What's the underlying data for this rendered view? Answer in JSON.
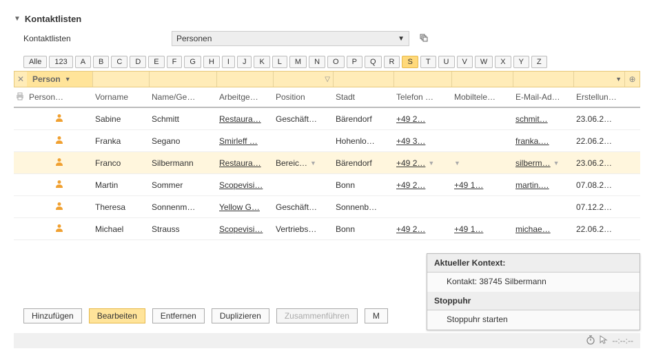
{
  "section": {
    "title": "Kontaktlisten"
  },
  "dropdown": {
    "label": "Kontaktlisten",
    "value": "Personen"
  },
  "alphaBar": {
    "all": "Alle",
    "nums": "123",
    "letters": [
      "A",
      "B",
      "C",
      "D",
      "E",
      "F",
      "G",
      "H",
      "I",
      "J",
      "K",
      "L",
      "M",
      "N",
      "O",
      "P",
      "Q",
      "R",
      "S",
      "T",
      "U",
      "V",
      "W",
      "X",
      "Y",
      "Z"
    ],
    "active": "S"
  },
  "filterHead": "Person",
  "columns": {
    "type": "Person…",
    "vorname": "Vorname",
    "name": "Name/Ge…",
    "arb": "Arbeitge…",
    "pos": "Position",
    "stadt": "Stadt",
    "tel": "Telefon …",
    "mob": "Mobiltele…",
    "email": "E-Mail-Ad…",
    "erst": "Erstellun…"
  },
  "rows": [
    {
      "vorname": "Sabine",
      "name": "Schmitt",
      "arb": "Restaura…",
      "pos": "Geschäft…",
      "stadt": "Bärendorf",
      "tel": "+49 2…",
      "mob": "",
      "email": "schmit…",
      "erst": "23.06.2…"
    },
    {
      "vorname": "Franka",
      "name": "Segano",
      "arb": "Smirleff …",
      "pos": "",
      "stadt": "Hohenlo…",
      "tel": "+49 3…",
      "mob": "",
      "email": "franka.…",
      "erst": "22.06.2…"
    },
    {
      "vorname": "Franco",
      "name": "Silbermann",
      "arb": "Restaura…",
      "pos": "Bereic…",
      "stadt": "Bärendorf",
      "tel": "+49 2…",
      "mob": "",
      "email": "silberm…",
      "erst": "23.06.2…",
      "selected": true
    },
    {
      "vorname": "Martin",
      "name": "Sommer",
      "arb": "Scopevisi…",
      "pos": "",
      "stadt": "Bonn",
      "tel": "+49 2…",
      "mob": "+49 1…",
      "email": "martin.…",
      "erst": "07.08.2…"
    },
    {
      "vorname": "Theresa",
      "name": "Sonnenm…",
      "arb": "Yellow G…",
      "pos": "Geschäft…",
      "stadt": "Sonnenb…",
      "tel": "",
      "mob": "",
      "email": "",
      "erst": "07.12.2…"
    },
    {
      "vorname": "Michael",
      "name": "Strauss",
      "arb": "Scopevisi…",
      "pos": "Vertriebs…",
      "stadt": "Bonn",
      "tel": "+49 2…",
      "mob": "+49 1…",
      "email": "michae…",
      "erst": "22.06.2…"
    }
  ],
  "buttons": {
    "add": "Hinzufügen",
    "edit": "Bearbeiten",
    "remove": "Entfernen",
    "dup": "Duplizieren",
    "merge": "Zusammenführen",
    "m": "M"
  },
  "context": {
    "header1": "Aktueller Kontext:",
    "line1": "Kontakt: 38745 Silbermann",
    "header2": "Stoppuhr",
    "line2": "Stoppuhr starten"
  },
  "status": {
    "time": "--:--:--"
  }
}
